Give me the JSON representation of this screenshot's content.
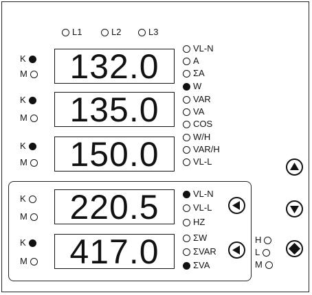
{
  "phases": [
    "L1",
    "L2",
    "L3"
  ],
  "displays": [
    {
      "value": "132.0",
      "k_on": true,
      "m_on": false
    },
    {
      "value": "135.0",
      "k_on": true,
      "m_on": false
    },
    {
      "value": "150.0",
      "k_on": true,
      "m_on": false
    },
    {
      "value": "220.5",
      "k_on": false,
      "m_on": false
    },
    {
      "value": "417.0",
      "k_on": true,
      "m_on": false
    }
  ],
  "k_label": "K",
  "m_label": "M",
  "upper_indicators": [
    {
      "label": "VL-N",
      "on": false
    },
    {
      "label": "A",
      "on": false
    },
    {
      "label": "ΣA",
      "on": false
    },
    {
      "label": "W",
      "on": true
    },
    {
      "label": "VAR",
      "on": false
    },
    {
      "label": "VA",
      "on": false
    },
    {
      "label": "COS",
      "on": false
    },
    {
      "label": "W/H",
      "on": false
    },
    {
      "label": "VAR/H",
      "on": false
    },
    {
      "label": "VL-L",
      "on": false
    }
  ],
  "lower_indicators": [
    {
      "label": "VL-N",
      "on": true
    },
    {
      "label": "VL-L",
      "on": false
    },
    {
      "label": "HZ",
      "on": false
    },
    {
      "label": "ΣW",
      "on": false
    },
    {
      "label": "ΣVAR",
      "on": false
    },
    {
      "label": "ΣVA",
      "on": true
    }
  ],
  "hlm": [
    {
      "label": "H",
      "on": false
    },
    {
      "label": "L",
      "on": false
    },
    {
      "label": "M",
      "on": false
    }
  ],
  "buttons": {
    "up": "up-triangle-icon",
    "down": "down-triangle-icon",
    "enter": "diamond-icon",
    "left": "left-triangle-icon"
  }
}
